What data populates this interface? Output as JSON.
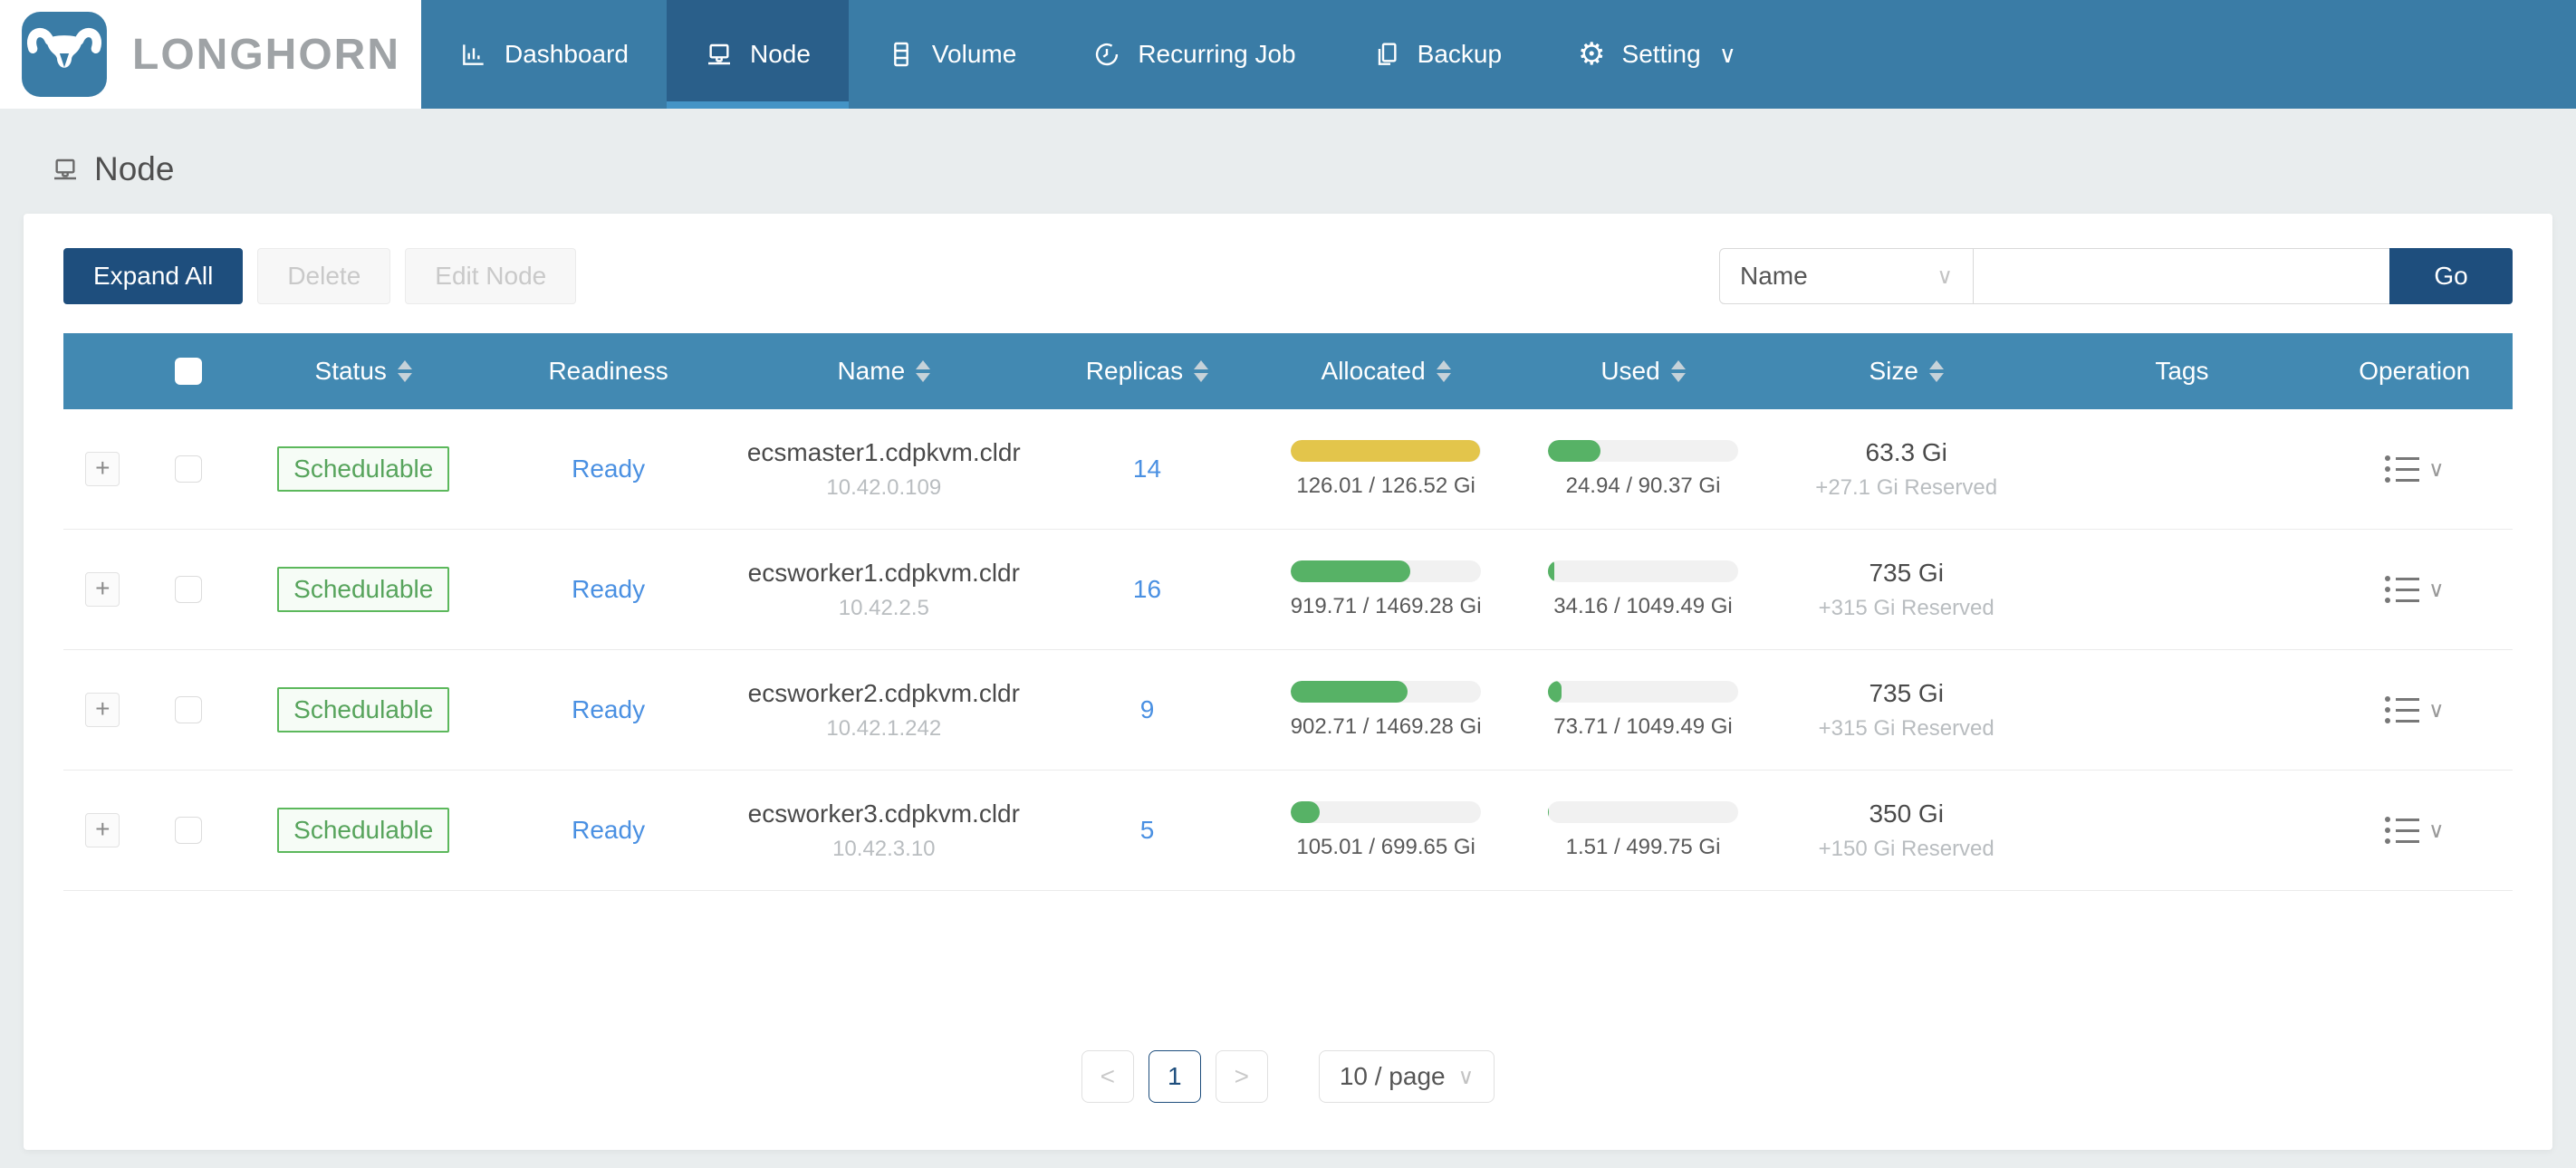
{
  "brand": {
    "name": "LONGHORN"
  },
  "nav": {
    "items": [
      {
        "label": "Dashboard",
        "icon": "dashboard-icon",
        "active": false
      },
      {
        "label": "Node",
        "icon": "node-icon",
        "active": true
      },
      {
        "label": "Volume",
        "icon": "volume-icon",
        "active": false
      },
      {
        "label": "Recurring Job",
        "icon": "clock-icon",
        "active": false
      },
      {
        "label": "Backup",
        "icon": "backup-icon",
        "active": false
      },
      {
        "label": "Setting",
        "icon": "gear-icon",
        "active": false,
        "has_dropdown": true
      }
    ]
  },
  "page": {
    "title": "Node"
  },
  "toolbar": {
    "expand_all_label": "Expand All",
    "delete_label": "Delete",
    "edit_node_label": "Edit Node"
  },
  "search": {
    "field_selected": "Name",
    "input_value": "",
    "go_label": "Go"
  },
  "table": {
    "columns": [
      {
        "label": "Status",
        "sortable": true
      },
      {
        "label": "Readiness",
        "sortable": false
      },
      {
        "label": "Name",
        "sortable": true
      },
      {
        "label": "Replicas",
        "sortable": true
      },
      {
        "label": "Allocated",
        "sortable": true
      },
      {
        "label": "Used",
        "sortable": true
      },
      {
        "label": "Size",
        "sortable": true
      },
      {
        "label": "Tags",
        "sortable": false
      },
      {
        "label": "Operation",
        "sortable": false
      }
    ],
    "rows": [
      {
        "status": "Schedulable",
        "readiness": "Ready",
        "name": "ecsmaster1.cdpkvm.cldr",
        "ip": "10.42.0.109",
        "replicas": "14",
        "allocated": {
          "label": "126.01 / 126.52 Gi",
          "percent": 99.6,
          "color": "#e3c54b"
        },
        "used": {
          "label": "24.94 / 90.37 Gi",
          "percent": 27.6,
          "color": "#57b266"
        },
        "size": "63.3 Gi",
        "reserved": "+27.1 Gi Reserved",
        "tags": ""
      },
      {
        "status": "Schedulable",
        "readiness": "Ready",
        "name": "ecsworker1.cdpkvm.cldr",
        "ip": "10.42.2.5",
        "replicas": "16",
        "allocated": {
          "label": "919.71 / 1469.28 Gi",
          "percent": 62.6,
          "color": "#57b266"
        },
        "used": {
          "label": "34.16 / 1049.49 Gi",
          "percent": 3.3,
          "color": "#57b266"
        },
        "size": "735 Gi",
        "reserved": "+315 Gi Reserved",
        "tags": ""
      },
      {
        "status": "Schedulable",
        "readiness": "Ready",
        "name": "ecsworker2.cdpkvm.cldr",
        "ip": "10.42.1.242",
        "replicas": "9",
        "allocated": {
          "label": "902.71 / 1469.28 Gi",
          "percent": 61.4,
          "color": "#57b266"
        },
        "used": {
          "label": "73.71 / 1049.49 Gi",
          "percent": 7.0,
          "color": "#57b266"
        },
        "size": "735 Gi",
        "reserved": "+315 Gi Reserved",
        "tags": ""
      },
      {
        "status": "Schedulable",
        "readiness": "Ready",
        "name": "ecsworker3.cdpkvm.cldr",
        "ip": "10.42.3.10",
        "replicas": "5",
        "allocated": {
          "label": "105.01 / 699.65 Gi",
          "percent": 15.0,
          "color": "#57b266"
        },
        "used": {
          "label": "1.51 / 499.75 Gi",
          "percent": 0.3,
          "color": "#57b266"
        },
        "size": "350 Gi",
        "reserved": "+150 Gi Reserved",
        "tags": ""
      }
    ]
  },
  "pagination": {
    "prev": "<",
    "current_page": "1",
    "next": ">",
    "page_size": "10 / page"
  },
  "colors": {
    "nav_bg": "#3a7ca6",
    "nav_active_bg": "#2a5f8a",
    "nav_active_strip": "#4494c6",
    "table_header_bg": "#4289b2",
    "primary_button": "#1e4e7d",
    "link_blue": "#4a90e2",
    "badge_green": "#5cb85c",
    "bar_yellow": "#e3c54b",
    "bar_green": "#57b266",
    "page_bg": "#e9edee"
  }
}
